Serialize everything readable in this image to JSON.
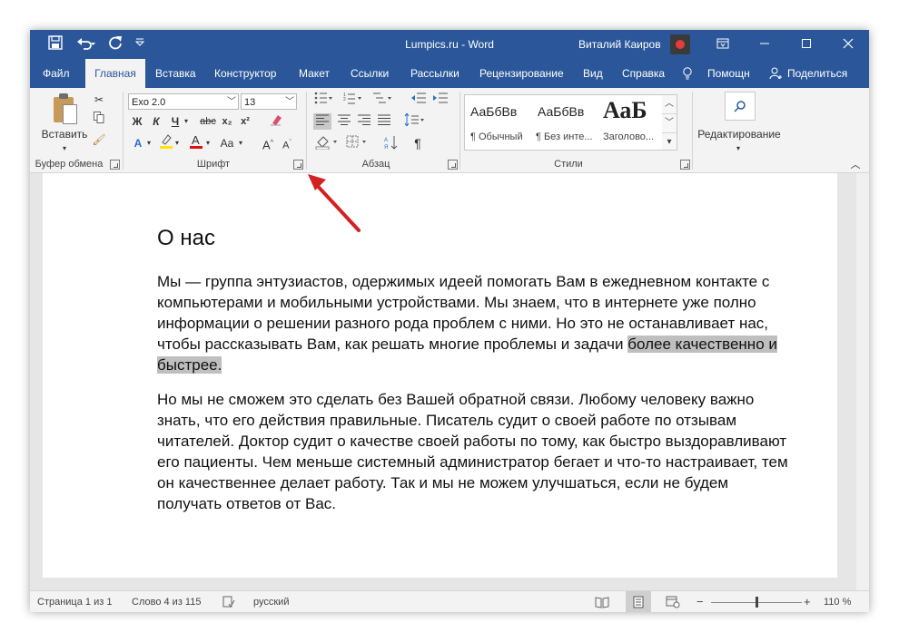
{
  "titlebar": {
    "title": "Lumpics.ru  -  Word",
    "user_name": "Виталий Каиров",
    "qat": {
      "save_icon": "save-icon",
      "undo_icon": "undo-icon",
      "redo_icon": "redo-icon",
      "customize_icon": "customize-qat-icon"
    }
  },
  "tabs": [
    {
      "label": "Файл"
    },
    {
      "label": "Главная"
    },
    {
      "label": "Вставка"
    },
    {
      "label": "Конструктор"
    },
    {
      "label": "Макет"
    },
    {
      "label": "Ссылки"
    },
    {
      "label": "Рассылки"
    },
    {
      "label": "Рецензирование"
    },
    {
      "label": "Вид"
    },
    {
      "label": "Справка"
    },
    {
      "label": "Помощн"
    },
    {
      "label": "Поделиться"
    }
  ],
  "ribbon": {
    "clipboard": {
      "paste_label": "Вставить",
      "group_label": "Буфер обмена"
    },
    "font": {
      "font_name": "Exo 2.0",
      "font_size": "13",
      "bold": "Ж",
      "italic": "К",
      "underline": "Ч",
      "strike": "abc",
      "subscript": "x₂",
      "superscript": "x²",
      "change_case": "Aa",
      "grow": "A",
      "shrink": "A",
      "group_label": "Шрифт"
    },
    "paragraph": {
      "group_label": "Абзац",
      "pilcrow": "¶"
    },
    "styles": {
      "items": [
        {
          "sample": "АаБбВв",
          "name": "¶ Обычный"
        },
        {
          "sample": "АаБбВв",
          "name": "¶ Без инте..."
        },
        {
          "sample": "АаБ",
          "name": "Заголово..."
        }
      ],
      "group_label": "Стили"
    },
    "editing": {
      "label": "Редактирование"
    }
  },
  "document": {
    "heading": "О нас",
    "para1_main": "Мы — группа энтузиастов, одержимых идеей помогать Вам в ежедневном контакте с компьютерами и мобильными устройствами. Мы знаем, что в интернете уже полно информации о решении разного рода проблем с ними. Но это не останавливает нас, чтобы рассказывать Вам, как решать многие проблемы и задачи ",
    "para1_selected": "более качественно и быстрее.",
    "para2": "Но мы не сможем это сделать без Вашей обратной связи. Любому человеку важно знать, что его действия правильные. Писатель судит о своей работе по отзывам читателей. Доктор судит о качестве своей работы по тому, как быстро выздоравливают его пациенты. Чем меньше системный администратор бегает и что-то настраивает, тем он качественнее делает работу. Так и мы не можем улучшаться, если не будем получать ответов от Вас."
  },
  "status": {
    "page": "Страница 1 из 1",
    "words": "Слово 4 из 115",
    "language": "русский",
    "zoom": "110 %",
    "zoom_minus": "−",
    "zoom_plus": "+"
  },
  "colors": {
    "accent": "#2b579a",
    "selection": "#bfbfbf",
    "arrow": "#d42020"
  }
}
